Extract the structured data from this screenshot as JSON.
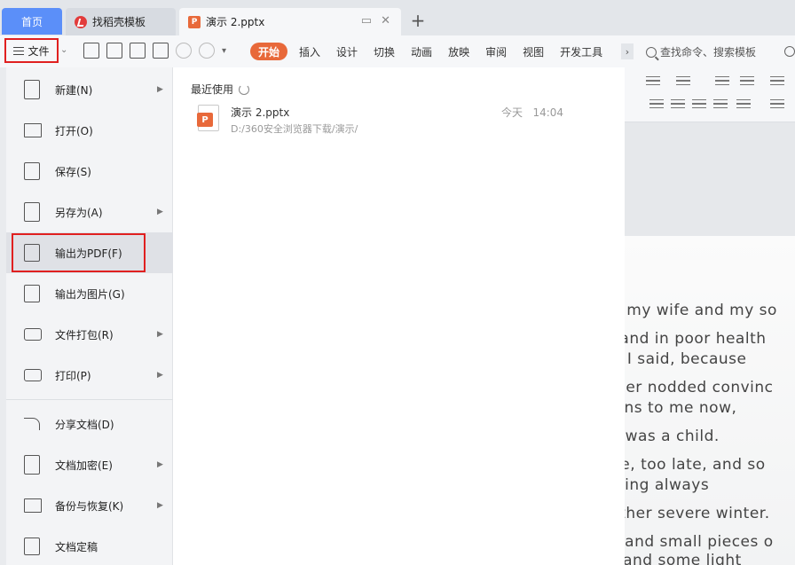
{
  "tabs": {
    "home": "首页",
    "template": "找稻壳模板",
    "document": "演示 2.pptx",
    "add": "+"
  },
  "toolbar": {
    "file_label": "文件",
    "ribbon_tabs": [
      "开始",
      "插入",
      "设计",
      "切换",
      "动画",
      "放映",
      "审阅",
      "视图",
      "开发工具"
    ],
    "more": "›",
    "search_placeholder": "查找命令、搜索模板"
  },
  "file_menu": {
    "items": [
      {
        "label": "新建(N)",
        "icon": "new-icon",
        "submenu": true
      },
      {
        "label": "打开(O)",
        "icon": "folder-icon",
        "submenu": false
      },
      {
        "label": "保存(S)",
        "icon": "save-icon",
        "submenu": false
      },
      {
        "label": "另存为(A)",
        "icon": "save-as-icon",
        "submenu": true
      },
      {
        "label": "输出为PDF(F)",
        "icon": "pdf-export-icon",
        "submenu": false,
        "highlighted": true
      },
      {
        "label": "输出为图片(G)",
        "icon": "image-export-icon",
        "submenu": false
      },
      {
        "label": "文件打包(R)",
        "icon": "package-icon",
        "submenu": true
      },
      {
        "label": "打印(P)",
        "icon": "print-icon",
        "submenu": true
      },
      {
        "label": "分享文档(D)",
        "icon": "share-icon",
        "submenu": false
      },
      {
        "label": "文档加密(E)",
        "icon": "encrypt-icon",
        "submenu": true
      },
      {
        "label": "备份与恢复(K)",
        "icon": "backup-icon",
        "submenu": true
      },
      {
        "label": "文档定稿",
        "icon": "finalize-icon",
        "submenu": false
      }
    ]
  },
  "recent": {
    "title": "最近使用",
    "files": [
      {
        "name": "演示 2.pptx",
        "path": "D:/360安全浏览器下载/演示/",
        "day": "今天",
        "time": "14:04"
      }
    ]
  },
  "slide": {
    "lines": [
      "er, my wife and my so",
      "ld and in poor health",
      "ay. I said, because",
      "other nodded convinc",
      "stens to me now,",
      "n I was a child.",
      "late, too late, and so",
      "spring always",
      "nother severe winter.",
      "ge and small pieces o",
      "ck and some light"
    ]
  }
}
